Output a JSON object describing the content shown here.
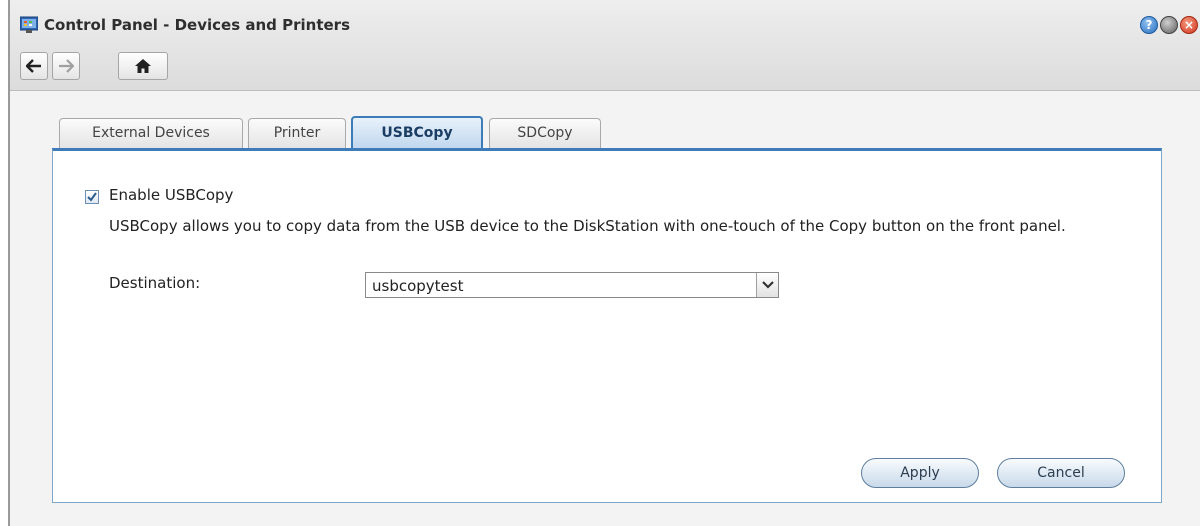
{
  "window": {
    "title": "Control Panel - Devices and Printers",
    "help_label": "?",
    "close_label": "×"
  },
  "tabs": [
    {
      "label": "External Devices",
      "active": false
    },
    {
      "label": "Printer",
      "active": false
    },
    {
      "label": "USBCopy",
      "active": true
    },
    {
      "label": "SDCopy",
      "active": false
    }
  ],
  "usbcopy": {
    "enable_label": "Enable USBCopy",
    "enabled": true,
    "description": "USBCopy allows you to copy data from the USB device to the DiskStation with one-touch of the Copy button on the front panel.",
    "destination_label": "Destination:",
    "destination_value": "usbcopytest"
  },
  "buttons": {
    "apply": "Apply",
    "cancel": "Cancel"
  },
  "colors": {
    "accent": "#3d7cb8",
    "panel_border": "#7ea7cc"
  }
}
